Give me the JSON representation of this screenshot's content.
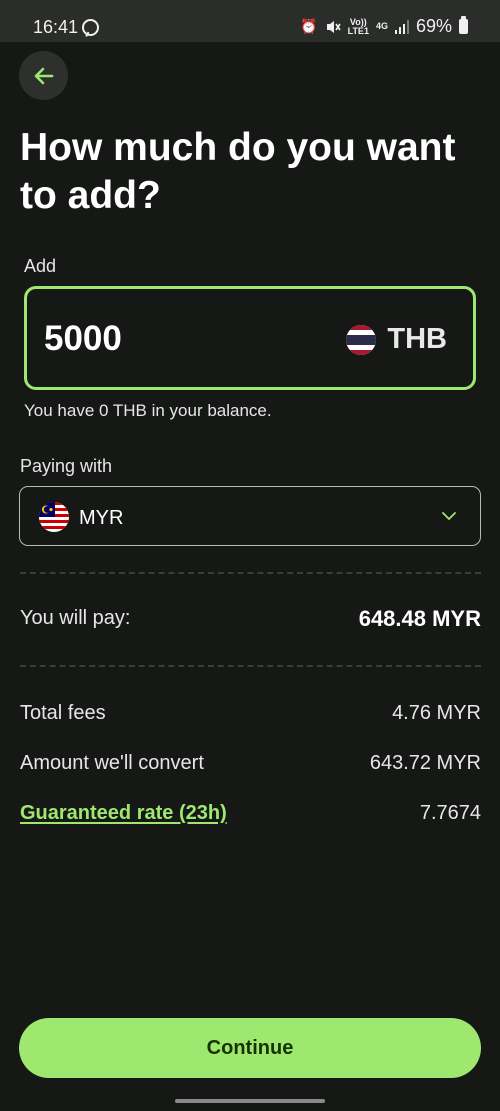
{
  "status_bar": {
    "time": "16:41",
    "network_top": "Vo))",
    "network_bottom": "LTE1",
    "net_type": "4G",
    "battery": "69%"
  },
  "title": "How much do you want to add?",
  "add_field": {
    "label": "Add",
    "amount": "5000",
    "currency": "THB",
    "balance_note": "You have 0 THB in your balance."
  },
  "paying": {
    "label": "Paying with",
    "currency": "MYR"
  },
  "summary": {
    "pay_label": "You will pay:",
    "pay_value": "648.48 MYR",
    "fees_label": "Total fees",
    "fees_value": "4.76 MYR",
    "convert_label": "Amount we'll convert",
    "convert_value": "643.72 MYR",
    "rate_label": "Guaranteed rate (23h)",
    "rate_value": "7.7674"
  },
  "continue_label": "Continue",
  "colors": {
    "accent": "#9fe870",
    "background": "#161816",
    "button_text": "#163300"
  }
}
